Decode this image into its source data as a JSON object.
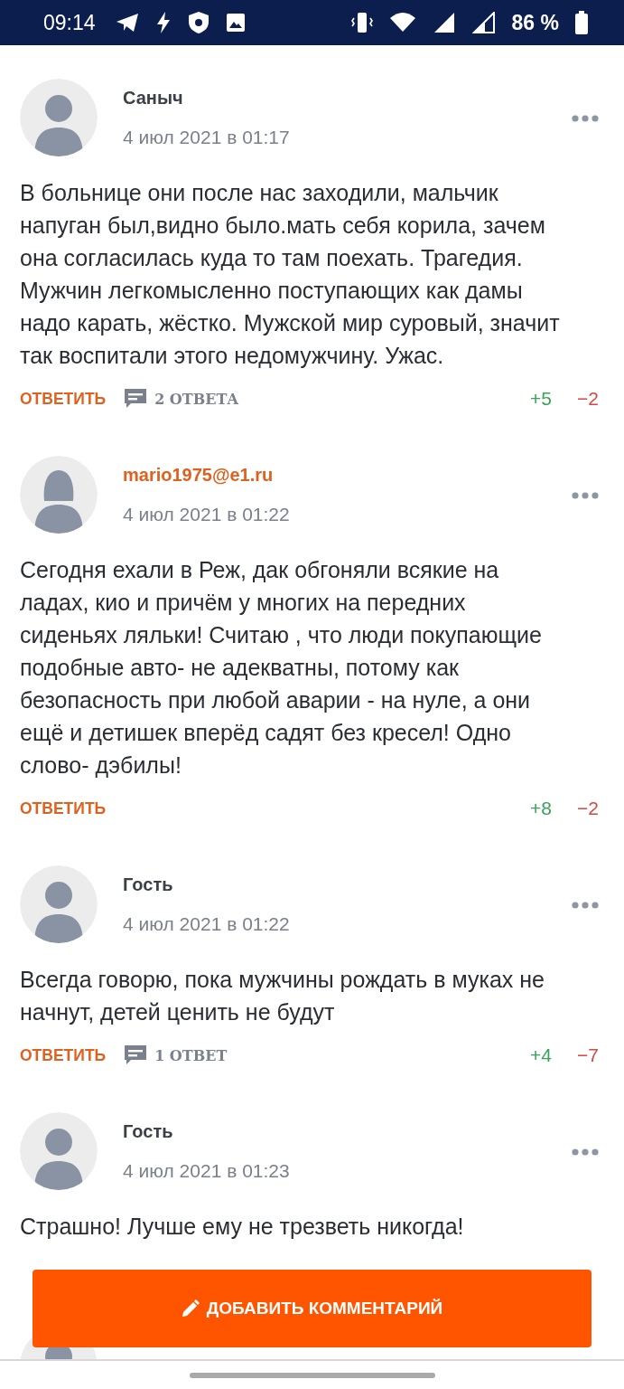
{
  "status_bar": {
    "time": "09:14",
    "battery": "86 %"
  },
  "comments": [
    {
      "author": "Саныч",
      "avatar": {
        "kind": "male"
      },
      "registered": false,
      "date": "4 июл 2021 в 01:17",
      "text": "В больнице они после нас заходили, мальчик напуган был,видно было.мать себя корила, зачем она согласилась куда то там поехать. Трагедия. Мужчин легкомысленно поступающих как дамы надо карать, жёстко. Мужской мир суровый, значит так воспитали этого недомужчину. Ужас.",
      "reply_label": "ОТВЕТИТЬ",
      "replies": "2 ОТВЕТА",
      "likes": "+5",
      "dislikes": "−2"
    },
    {
      "author": "mario1975@e1.ru",
      "avatar": {
        "kind": "female"
      },
      "registered": true,
      "date": "4 июл 2021 в 01:22",
      "text": "Сегодня ехали в Реж, дак обгоняли всякие на ладах, кио и причём у многих на передних сиденьях ляльки! Считаю , что люди покупающие подобные авто- не адекватны, потому как безопасность при любой аварии - на нуле, а они ещё и детишек вперёд садят без кресел! Одно слово- дэбилы!",
      "reply_label": "ОТВЕТИТЬ",
      "likes": "+8",
      "dislikes": "−2"
    },
    {
      "author": "Гость",
      "avatar": {
        "kind": "male"
      },
      "registered": false,
      "date": "4 июл 2021 в 01:22",
      "text": "Всегда говорю, пока мужчины рождать в муках не начнут, детей ценить не будут",
      "reply_label": "ОТВЕТИТЬ",
      "replies": "1 ОТВЕТ",
      "likes": "+4",
      "dislikes": "−7"
    },
    {
      "author": "Гость",
      "avatar": {
        "kind": "male"
      },
      "registered": false,
      "date": "4 июл 2021 в 01:23",
      "text": "Страшно! Лучше ему не трезветь никогда!"
    },
    {
      "avatar": {
        "kind": "male"
      }
    }
  ],
  "add_comment_button": {
    "label": "ДОБАВИТЬ КОММЕНТАРИЙ"
  }
}
